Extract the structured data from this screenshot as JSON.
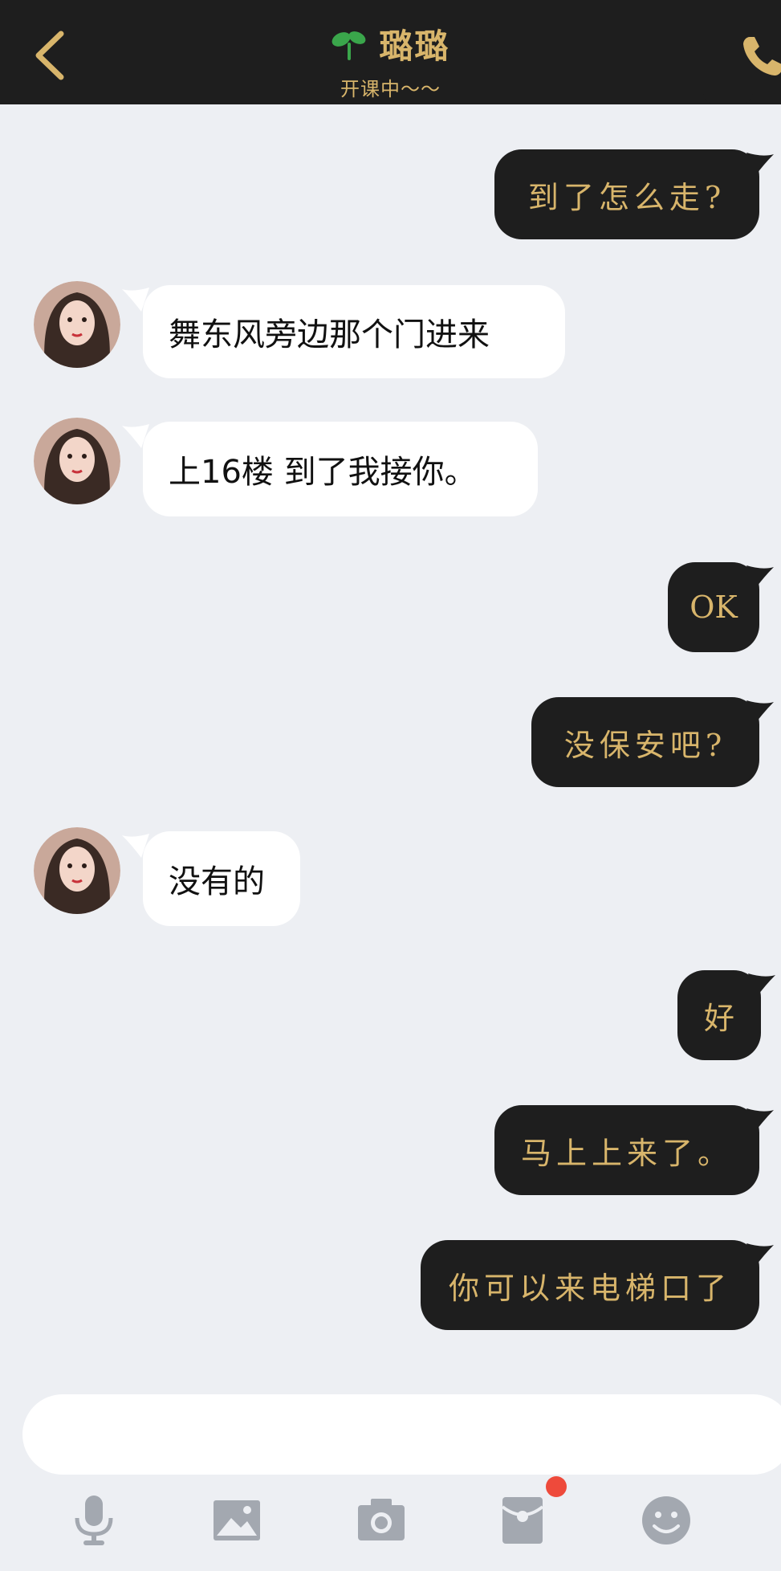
{
  "header": {
    "title": "璐璐",
    "subtitle": "开课中～～",
    "back_icon": "chevron-left-icon",
    "call_icon": "phone-icon",
    "title_icon": "sprout-icon"
  },
  "colors": {
    "header_bg": "#1e1e1e",
    "accent_gold": "#d8b56b",
    "chat_bg": "#edeff3",
    "incoming_bubble": "#ffffff",
    "outgoing_bubble": "#1e1e1e",
    "badge_red": "#ee4a3b"
  },
  "messages": [
    {
      "side": "out",
      "text": "到了怎么走?"
    },
    {
      "side": "in",
      "text": "舞东风旁边那个门进来"
    },
    {
      "side": "in",
      "text": "上16楼 到了我接你。"
    },
    {
      "side": "out",
      "text": "OK"
    },
    {
      "side": "out",
      "text": "没保安吧?"
    },
    {
      "side": "in",
      "text": "没有的"
    },
    {
      "side": "out",
      "text": "好"
    },
    {
      "side": "out",
      "text": "马上上来了。"
    },
    {
      "side": "out",
      "text": "你可以来电梯口了"
    }
  ],
  "input": {
    "placeholder": ""
  },
  "toolbar": {
    "icons": [
      "microphone-icon",
      "image-icon",
      "camera-icon",
      "red-packet-icon",
      "emoji-icon"
    ],
    "has_badge_on": "red-packet-icon"
  }
}
